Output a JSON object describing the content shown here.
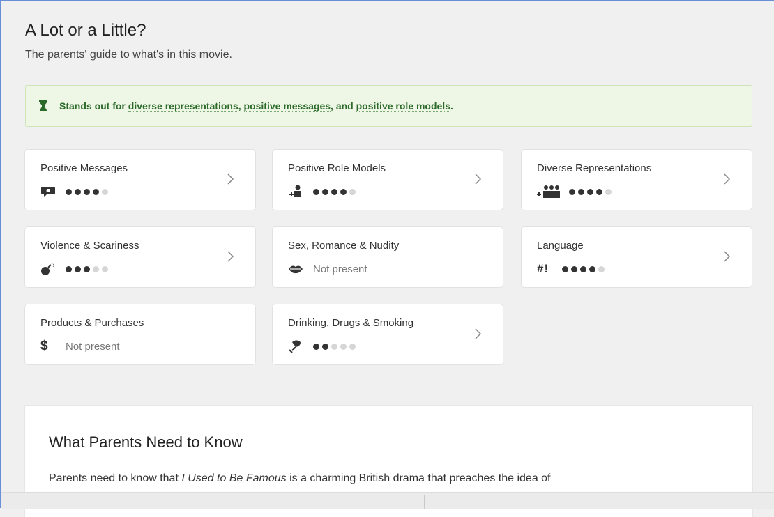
{
  "header": {
    "title": "A Lot or a Little?",
    "subtitle": "The parents' guide to what's in this movie."
  },
  "standout": {
    "prefix": "Stands out for ",
    "link1": "diverse representations",
    "sep1": ", ",
    "link2": "positive messages",
    "sep2": ", and ",
    "link3": "positive role models",
    "suffix": "."
  },
  "cards": [
    {
      "label": "Positive Messages",
      "icon": "speech-bubble-icon",
      "rating": 4,
      "max": 5
    },
    {
      "label": "Positive Role Models",
      "icon": "role-model-icon",
      "rating": 4,
      "max": 5
    },
    {
      "label": "Diverse Representations",
      "icon": "group-icon",
      "rating": 4,
      "max": 5
    },
    {
      "label": "Violence & Scariness",
      "icon": "bomb-icon",
      "rating": 3,
      "max": 5
    },
    {
      "label": "Sex, Romance & Nudity",
      "icon": "lips-icon",
      "status": "Not present"
    },
    {
      "label": "Language",
      "icon": "hashbang-icon",
      "icon_text": "#!",
      "rating": 4,
      "max": 5
    },
    {
      "label": "Products & Purchases",
      "icon": "dollar-icon",
      "icon_text": "$",
      "status": "Not present"
    },
    {
      "label": "Drinking, Drugs & Smoking",
      "icon": "glass-icon",
      "rating": 2,
      "max": 5
    }
  ],
  "know": {
    "heading": "What Parents Need to Know",
    "text_before": "Parents need to know that ",
    "text_title": "I Used to Be Famous",
    "text_after": " is a charming British drama that preaches the idea of"
  },
  "colors": {
    "standout_bg": "#eef6e6",
    "standout_text": "#2b6a28",
    "dot_on": "#333333",
    "dot_off": "#d6d6d6",
    "frame_accent": "#6b8fd6"
  }
}
